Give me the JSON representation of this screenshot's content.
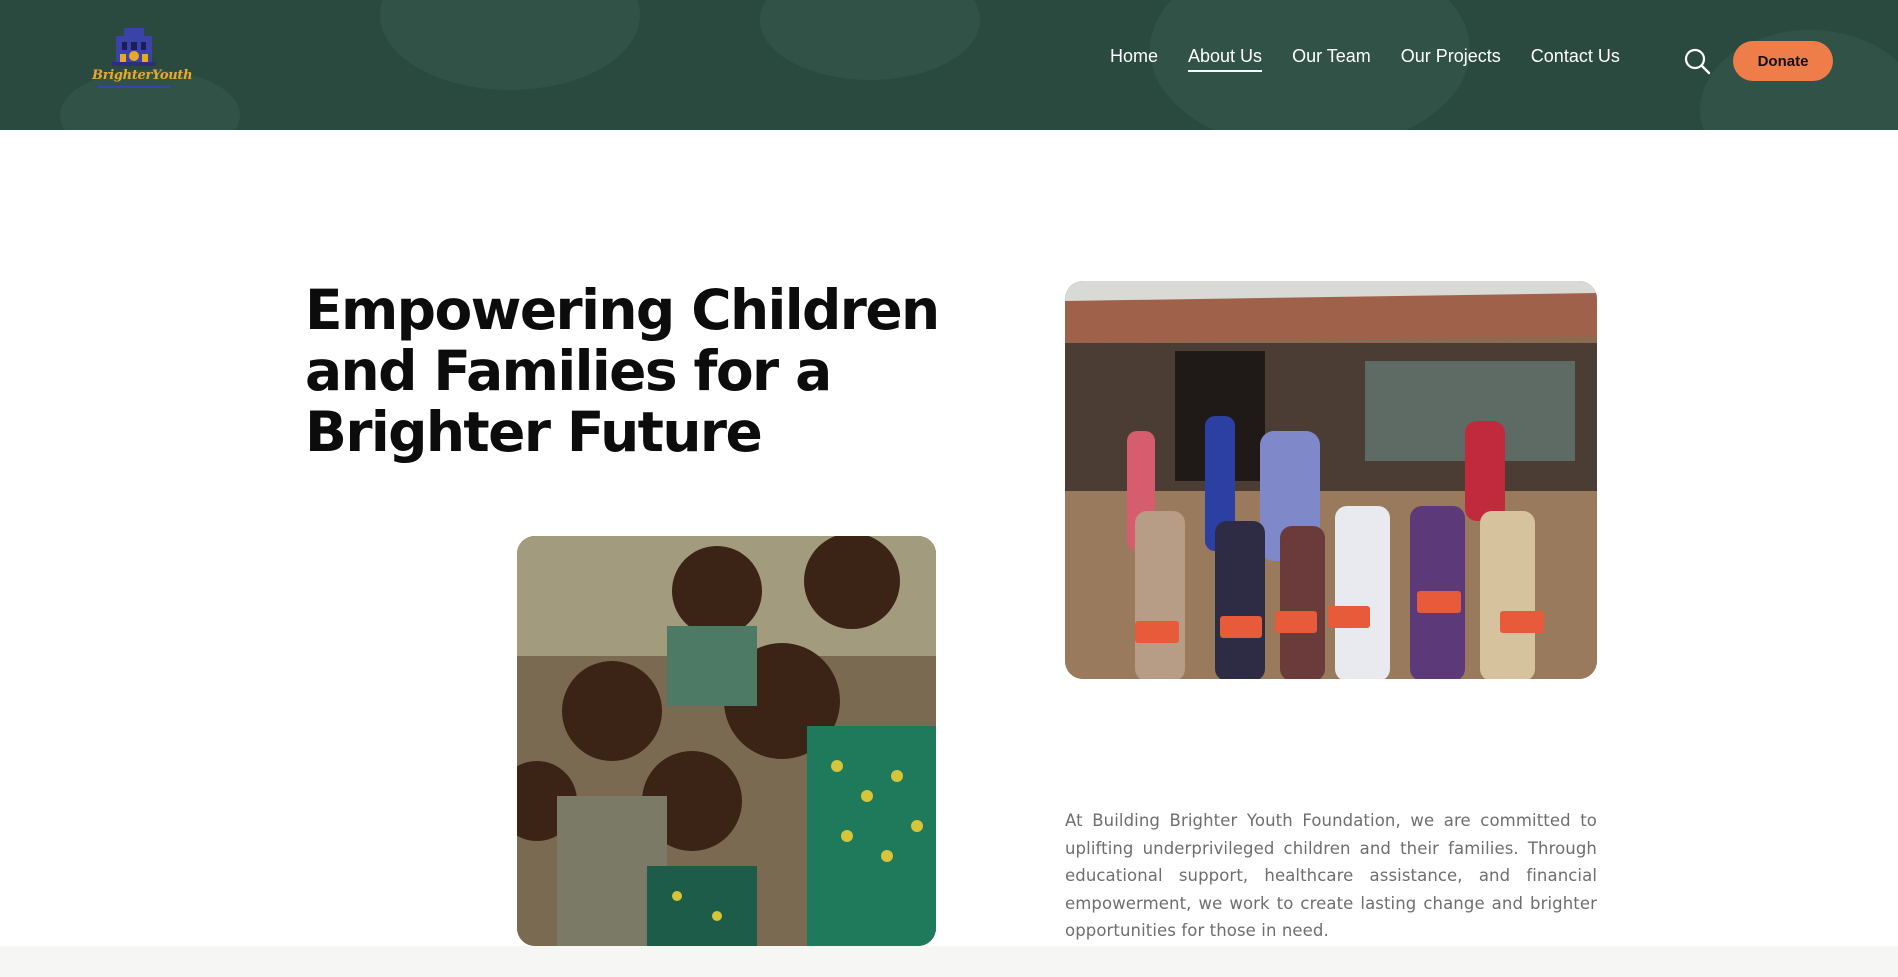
{
  "brand": {
    "logo_text": "BrighterYouth",
    "logo_icon": "building-logo-icon"
  },
  "nav": {
    "items": [
      {
        "label": "Home",
        "active": false
      },
      {
        "label": "About Us",
        "active": true
      },
      {
        "label": "Our Team",
        "active": false
      },
      {
        "label": "Our Projects",
        "active": false
      },
      {
        "label": "Contact Us",
        "active": false
      }
    ],
    "search_icon": "search-icon",
    "donate_label": "Donate"
  },
  "hero": {
    "title": "Empowering Children and Families for a Brighter Future",
    "description": "At Building Brighter Youth Foundation, we are committed to uplifting underprivileged children and their families. Through educational support, healthcare assistance, and financial empowerment, we work to create lasting change and brighter opportunities for those in need."
  },
  "colors": {
    "header_bg": "#2a4a40",
    "accent": "#ee7d4a",
    "logo_gold": "#e9a82a",
    "logo_blue": "#3c43a6",
    "body_text": "#6e6e6e"
  }
}
